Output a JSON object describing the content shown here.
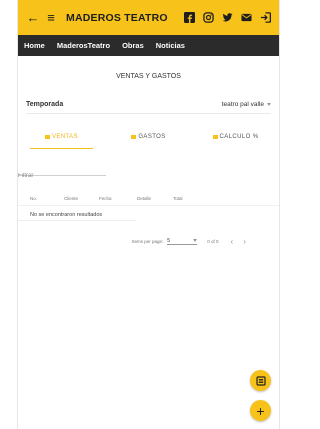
{
  "topbar": {
    "title": "MADEROS TEATRO",
    "back_icon": "←",
    "menu_icon": "≡"
  },
  "nav": {
    "items": [
      "Home",
      "MaderosTeatro",
      "Obras",
      "Noticias"
    ]
  },
  "page_title": "VENTAS Y GASTOS",
  "temporada": {
    "label": "Temporada",
    "value": "teatro pal valle"
  },
  "tabs": [
    {
      "label": "VENTAS",
      "active": true
    },
    {
      "label": "GASTOS",
      "active": false
    },
    {
      "label": "CALCULO %",
      "active": false
    }
  ],
  "filter": {
    "placeholder": "Filtrar"
  },
  "table": {
    "columns": [
      "No.",
      "Cliente",
      "Fecha",
      "Detalle",
      "Total"
    ],
    "empty_message": "No se encontraron resultados"
  },
  "paginator": {
    "items_per_page_label": "Items per page:",
    "items_per_page_value": "5",
    "range_label": "0 of 0"
  },
  "colors": {
    "accent": "#f7c21a",
    "navbar": "#2b2b2b"
  },
  "fab": {
    "add_symbol": "+"
  }
}
